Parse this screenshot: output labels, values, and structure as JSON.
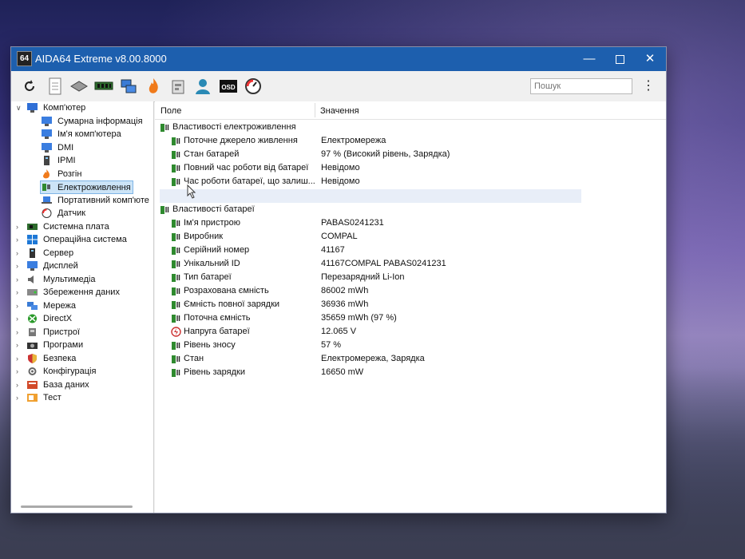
{
  "window": {
    "title": "AIDA64 Extreme v8.00.8000",
    "logo": "64"
  },
  "controls": {
    "minimize": "—",
    "close": "✕"
  },
  "toolbar": {
    "icons": [
      "refresh-icon",
      "report-icon",
      "motherboard-icon",
      "memory-icon",
      "network-icon",
      "flame-icon",
      "benchmark-icon",
      "user-icon",
      "osd-icon",
      "gauge-icon"
    ],
    "osd_label": "OSD",
    "search_placeholder": "Пошук",
    "menu_glyph": "⋮"
  },
  "tree": {
    "root": "Комп'ютер",
    "children": [
      "Сумарна інформація",
      "Ім'я комп'ютера",
      "DMI",
      "IPMI",
      "Розгін",
      "Електроживлення",
      "Портативний комп'юте",
      "Датчик"
    ],
    "selected": "Електроживлення",
    "groups": [
      "Системна плата",
      "Операційна система",
      "Сервер",
      "Дисплей",
      "Мультимедіа",
      "Збереження даних",
      "Мережа",
      "DirectX",
      "Пристрої",
      "Програми",
      "Безпека",
      "Конфігурація",
      "База даних",
      "Тест"
    ]
  },
  "table": {
    "col_field": "Поле",
    "col_value": "Значення",
    "section1": "Властивості електроживлення",
    "rows1": [
      {
        "field": "Поточне джерело живлення",
        "value": "Електромережа"
      },
      {
        "field": "Стан батарей",
        "value": "97 % (Високий рівень, Зарядка)"
      },
      {
        "field": "Повний час роботи від батареї",
        "value": "Невідомо"
      },
      {
        "field": "Час роботи батареї, що залиш...",
        "value": "Невідомо"
      }
    ],
    "section2": "Властивості батареї",
    "rows2": [
      {
        "field": "Ім'я пристрою",
        "value": "PABAS0241231"
      },
      {
        "field": "Виробник",
        "value": "COMPAL"
      },
      {
        "field": "Серійний номер",
        "value": "41167"
      },
      {
        "field": "Унікальний ID",
        "value": "41167COMPAL PABAS0241231"
      },
      {
        "field": "Тип батареї",
        "value": "Перезарядний Li-Ion"
      },
      {
        "field": "Розрахована ємність",
        "value": "86002 mWh"
      },
      {
        "field": "Ємність повної зарядки",
        "value": "36936 mWh"
      },
      {
        "field": "Поточна ємність",
        "value": "35659 mWh  (97 %)"
      },
      {
        "field": "Напруга батареї",
        "value": "12.065 V"
      },
      {
        "field": "Рівень зносу",
        "value": "57 %"
      },
      {
        "field": "Стан",
        "value": "Електромережа, Зарядка"
      },
      {
        "field": "Рівень зарядки",
        "value": "16650 mW"
      }
    ]
  }
}
